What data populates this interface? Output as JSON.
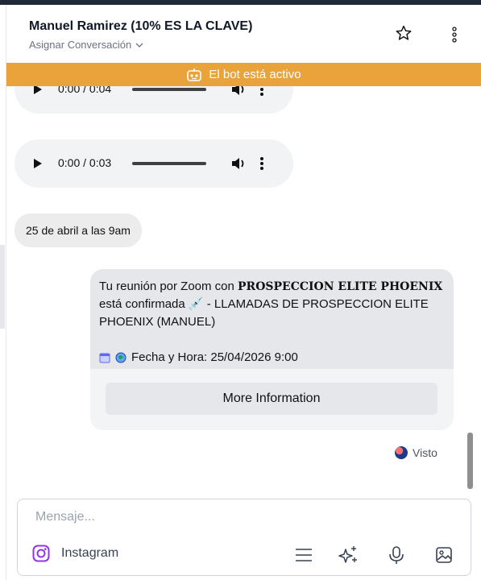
{
  "header": {
    "contact_name": "Manuel Ramirez (10% ES LA CLAVE)",
    "assign_label": "Asignar Conversación",
    "icons": [
      "star-icon",
      "kebab-menu-icon",
      "chevron-down-icon"
    ]
  },
  "bot_banner": {
    "text": "El bot está activo",
    "icon": "robot-icon",
    "color": "#eaa33b"
  },
  "messages": {
    "audio_1": {
      "time": "0:00 / 0:04"
    },
    "audio_2": {
      "time": "0:00 / 0:03"
    },
    "date_chip": "25 de abril a las 9am",
    "card": {
      "line_start": "Tu reunión por Zoom con ",
      "brand": "𝐏𝐑𝐎𝐒𝐏𝐄𝐂𝐂𝐈𝐎𝐍 𝐄𝐋𝐈𝐓𝐄 𝐏𝐇𝐎𝐄𝐍𝐈𝐗",
      "line_middle": " está confirmada 💉 ",
      "line_end": " - LLAMADAS DE PROSPECCION ELITE PHOENIX (MANUEL)",
      "datetime": "Fecha y Hora: 25/04/2026 9:00",
      "button_label": "More Information"
    },
    "status": "Visto"
  },
  "composer": {
    "placeholder": "Mensaje...",
    "channel_label": "Instagram",
    "icons": [
      "instagram-icon",
      "menu-lines-icon",
      "sparkle-ai-icon",
      "microphone-icon",
      "image-icon"
    ]
  }
}
